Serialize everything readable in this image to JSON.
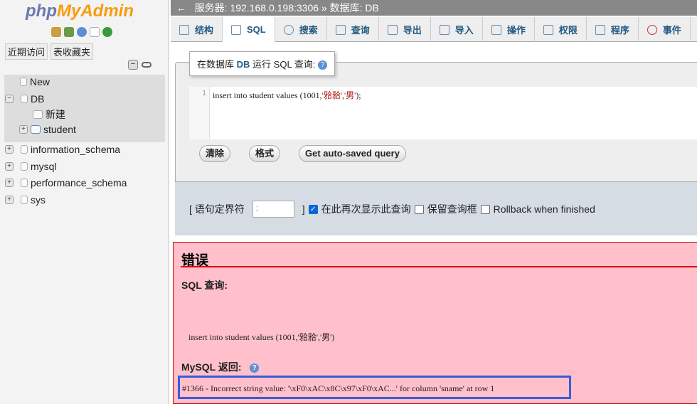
{
  "sidebar": {
    "logo_php": "php",
    "logo_myadmin": "MyAdmin",
    "recent": "近期访问",
    "favorites": "表收藏夹",
    "tree": {
      "new": "New",
      "db": "DB",
      "db_new": "新建",
      "student": "student",
      "dbs": [
        "information_schema",
        "mysql",
        "performance_schema",
        "sys"
      ]
    }
  },
  "breadcrumb": {
    "back": "←",
    "server": "服务器: 192.168.0.198:3306",
    "sep": "»",
    "database": "数据库: DB"
  },
  "tabs": [
    "结构",
    "SQL",
    "搜索",
    "查询",
    "导出",
    "导入",
    "操作",
    "权限",
    "程序",
    "事件"
  ],
  "sql_panel": {
    "legend_pre": "在数据库",
    "legend_db": "DB",
    "legend_post": "运行 SQL 查询:",
    "line_no": "1",
    "code_pre": "insert into student values (1001,",
    "code_str1": "'𬌗𬌗'",
    "code_comma": ",",
    "code_str2": "'男'",
    "code_post": ");",
    "clear": "清除",
    "format": "格式",
    "autosaved": "Get auto-saved query"
  },
  "options": {
    "delimiter_label": "[ 语句定界符",
    "delimiter_value": ";",
    "close_bracket": "]",
    "show_again": "在此再次显示此查询",
    "show_again_checked": true,
    "retain": "保留查询框",
    "retain_checked": false,
    "rollback": "Rollback when finished",
    "rollback_checked": false
  },
  "error": {
    "title": "错误",
    "sql_label": "SQL 查询:",
    "sql": "insert into student values (1001,'𬌗𬌗','男')",
    "return_label": "MySQL 返回:",
    "message": "#1366 - Incorrect string value: '\\xF0\\xAC\\x8C\\x97\\xF0\\xAC...' for column 'sname' at row 1"
  },
  "colors": {
    "error_bg": "#ffc0cb",
    "highlight": "#3a5bd9",
    "topbar": "#888888"
  }
}
